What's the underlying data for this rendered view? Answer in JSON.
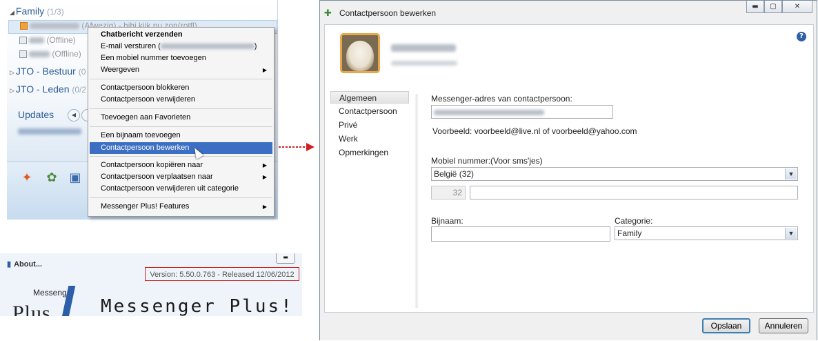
{
  "messenger": {
    "groups": [
      {
        "name": "Family",
        "count": "(1/3)"
      },
      {
        "name": "JTO - Bestuur",
        "count": "(0"
      },
      {
        "name": "JTO - Leden",
        "count": "(0/2"
      }
    ],
    "contacts": [
      {
        "status": "(Afwezig) - hihi kijk nu zon(rotfl)"
      },
      {
        "status": "(Offline)"
      },
      {
        "status": "(Offline)"
      }
    ],
    "updates_label": "Updates"
  },
  "context_menu": {
    "items": [
      {
        "label": "Chatbericht verzenden",
        "bold": true
      },
      {
        "label": "E-mail versturen (",
        "suffix": ")"
      },
      {
        "label": "Een mobiel nummer toevoegen"
      },
      {
        "label": "Weergeven",
        "submenu": true
      },
      {
        "label": "Contactpersoon blokkeren"
      },
      {
        "label": "Contactpersoon verwijderen"
      },
      {
        "label": "Toevoegen aan Favorieten"
      },
      {
        "label": "Een bijnaam toevoegen"
      },
      {
        "label": "Contactpersoon bewerken",
        "highlighted": true
      },
      {
        "label": "Contactpersoon kopiëren naar",
        "submenu": true
      },
      {
        "label": "Contactpersoon verplaatsen naar",
        "submenu": true
      },
      {
        "label": "Contactpersoon verwijderen uit categorie"
      },
      {
        "label": "Messenger Plus! Features",
        "submenu": true
      }
    ]
  },
  "about": {
    "title": "About...",
    "version": "Version: 5.50.0.763 - Released 12/06/2012",
    "logo_small": "Messenger",
    "logo_plus": "Plus",
    "logo_big": "Messenger Plus!"
  },
  "dialog": {
    "title": "Contactpersoon bewerken",
    "help": "?",
    "nav": [
      "Algemeen",
      "Contactpersoon",
      "Privé",
      "Werk",
      "Opmerkingen"
    ],
    "messenger_label": "Messenger-adres van contactpersoon:",
    "example_text": "Voorbeeld: voorbeeld@live.nl of voorbeeld@yahoo.com",
    "mobile_label": "Mobiel nummer:(Voor sms'jes)",
    "country_value": "België (32)",
    "country_code": "32",
    "nickname_label": "Bijnaam:",
    "category_label": "Categorie:",
    "category_value": "Family",
    "save_label": "Opslaan",
    "cancel_label": "Annuleren"
  },
  "colors": {
    "highlight": "#3c6fc3",
    "annotation_red": "#d21f1f",
    "link_blue": "#2a5a94"
  }
}
